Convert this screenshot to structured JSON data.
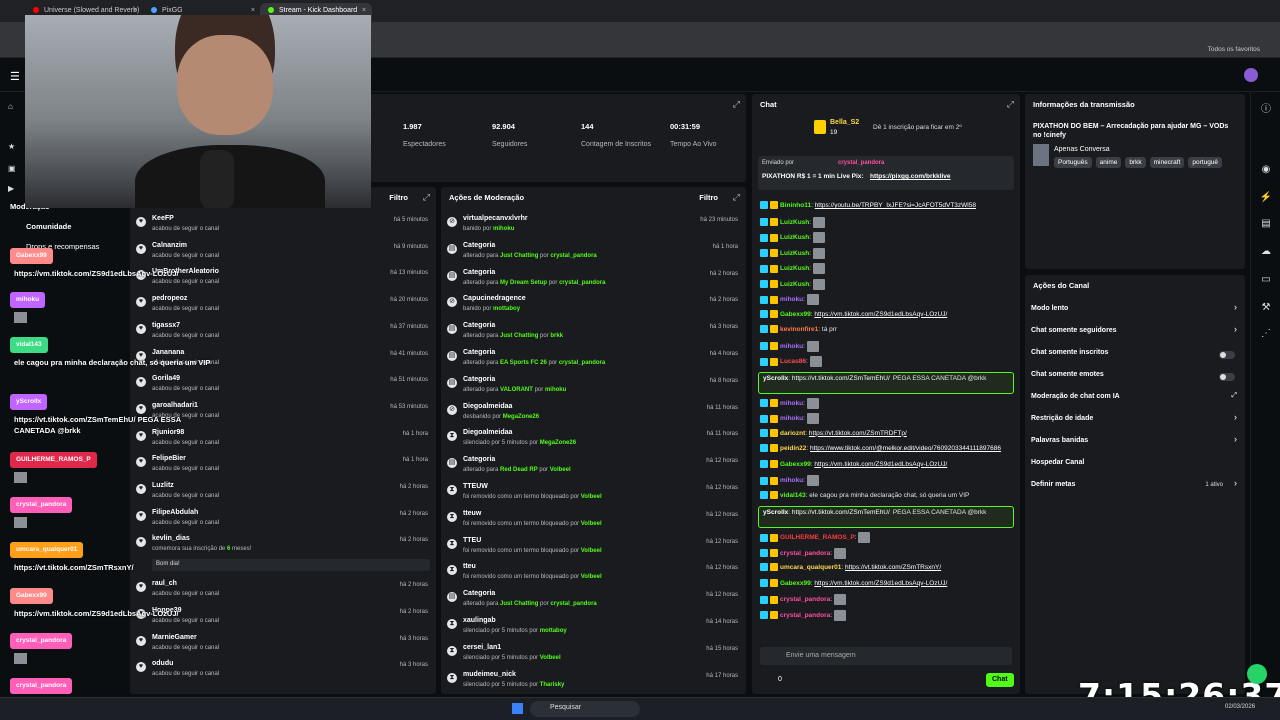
{
  "browser": {
    "tabs": [
      {
        "title": "Universe (Slowed and Reverb)",
        "color": "#ff0000"
      },
      {
        "title": "PixGG",
        "color": "#4aa3ff"
      },
      {
        "title": "Stream - Kick Dashboard",
        "color": "#53fc18"
      }
    ],
    "bookmarks_label": "Todos os favoritos"
  },
  "sidebar_menu": {
    "moderation": "Moderação",
    "community": "Comunidade",
    "drops": "Drops e recompensas"
  },
  "stats": [
    {
      "value": "1.987",
      "label": "Espectadores"
    },
    {
      "value": "92.904",
      "label": "Seguidores"
    },
    {
      "value": "144",
      "label": "Contagem de Inscritos"
    },
    {
      "value": "00:31:59",
      "label": "Tempo Ao Vivo"
    }
  ],
  "activity_feed": {
    "filter": "Filtro",
    "items": [
      {
        "name": "KeeFP",
        "desc": "acabou de seguir o canal",
        "time": "há 5 minutos"
      },
      {
        "name": "Calnanzim",
        "desc": "acabou de seguir o canal",
        "time": "há 9 minutos"
      },
      {
        "name": "UmBrotherAleatorio",
        "desc": "acabou de seguir o canal",
        "time": "há 13 minutos"
      },
      {
        "name": "pedropeoz",
        "desc": "acabou de seguir o canal",
        "time": "há 20 minutos"
      },
      {
        "name": "tigassx7",
        "desc": "acabou de seguir o canal",
        "time": "há 37 minutos"
      },
      {
        "name": "Jananana",
        "desc": "acabou de seguir o canal",
        "time": "há 41 minutos"
      },
      {
        "name": "Gorila49",
        "desc": "acabou de seguir o canal",
        "time": "há 51 minutos"
      },
      {
        "name": "garoalhadari1",
        "desc": "acabou de seguir o canal",
        "time": "há 53 minutos"
      },
      {
        "name": "Rjunior98",
        "desc": "acabou de seguir o canal",
        "time": "há 1 hora"
      },
      {
        "name": "FelipeBier",
        "desc": "acabou de seguir o canal",
        "time": "há 1 hora"
      },
      {
        "name": "Luzlitz",
        "desc": "acabou de seguir o canal",
        "time": "há 2 horas"
      },
      {
        "name": "FilipeAbdulah",
        "desc": "acabou de seguir o canal",
        "time": "há 2 horas"
      },
      {
        "name": "kevlin_dias",
        "desc": "comemora sua inscrição de",
        "months": "6",
        "suffix": "meses!",
        "time": "há 2 horas"
      },
      {
        "name": "raul_ch",
        "desc": "acabou de seguir o canal",
        "time": "há 2 horas"
      },
      {
        "name": "Hoppe39",
        "desc": "acabou de seguir o canal",
        "time": "há 2 horas"
      },
      {
        "name": "MarnieGamer",
        "desc": "acabou de seguir o canal",
        "time": "há 3 horas"
      },
      {
        "name": "odudu",
        "desc": "acabou de seguir o canal",
        "time": "há 3 horas"
      }
    ],
    "sub_message": "Bom dia!"
  },
  "moderation": {
    "title": "Ações de Moderação",
    "filter": "Filtro",
    "items": [
      {
        "icon": "ban",
        "name": "virtualpecanvxlvrhr",
        "desc": "banido por",
        "actor": "mihoku",
        "time": "há 23 minutos"
      },
      {
        "icon": "category",
        "name": "Categoria",
        "desc": "alterado para",
        "target": "Just Chatting",
        "by": "crystal_pandora",
        "time": "há 1 hora"
      },
      {
        "icon": "category",
        "name": "Categoria",
        "desc": "alterado para",
        "target": "My Dream Setup",
        "by": "crystal_pandora",
        "time": "há 2 horas"
      },
      {
        "icon": "ban",
        "name": "Capucinedragence",
        "desc": "banido por",
        "actor": "mottaboy",
        "time": "há 2 horas"
      },
      {
        "icon": "category",
        "name": "Categoria",
        "desc": "alterado para",
        "target": "Just Chatting",
        "by": "brkk",
        "time": "há 3 horas"
      },
      {
        "icon": "category",
        "name": "Categoria",
        "desc": "alterado para",
        "target": "EA Sports FC 26",
        "by": "crystal_pandora",
        "time": "há 4 horas"
      },
      {
        "icon": "category",
        "name": "Categoria",
        "desc": "alterado para",
        "target": "VALORANT",
        "by": "mihoku",
        "time": "há 8 horas"
      },
      {
        "icon": "ban",
        "name": "Diegoalmeidaa",
        "desc": "desbanido por",
        "actor": "MegaZone26",
        "time": "há 11 horas"
      },
      {
        "icon": "timeout",
        "name": "Diegoalmeidaa",
        "desc": "silenciado por 5 minutos por",
        "actor": "MegaZone26",
        "time": "há 11 horas"
      },
      {
        "icon": "category",
        "name": "Categoria",
        "desc": "alterado para",
        "target": "Red Dead RP",
        "by": "Volbeel",
        "time": "há 12 horas"
      },
      {
        "icon": "clock",
        "name": "TTEUW",
        "desc": "foi removido como um termo bloqueado por",
        "actor": "Volbeel",
        "time": "há 12 horas"
      },
      {
        "icon": "clock",
        "name": "tteuw",
        "desc": "foi removido como um termo bloqueado por",
        "actor": "Volbeel",
        "time": "há 12 horas"
      },
      {
        "icon": "clock",
        "name": "TTEU",
        "desc": "foi removido como um termo bloqueado por",
        "actor": "Volbeel",
        "time": "há 12 horas"
      },
      {
        "icon": "clock",
        "name": "tteu",
        "desc": "foi removido como um termo bloqueado por",
        "actor": "Volbeel",
        "time": "há 12 horas"
      },
      {
        "icon": "category",
        "name": "Categoria",
        "desc": "alterado para",
        "target": "Just Chatting",
        "by": "crystal_pandora",
        "time": "há 12 horas"
      },
      {
        "icon": "timeout",
        "name": "xaulingab",
        "desc": "silenciado por 5 minutos por",
        "actor": "mottaboy",
        "time": "há 14 horas"
      },
      {
        "icon": "timeout",
        "name": "cersei_lan1",
        "desc": "silenciado por 5 minutos por",
        "actor": "Volbeel",
        "time": "há 15 horas"
      },
      {
        "icon": "timeout",
        "name": "mudeimeu_nick",
        "desc": "silenciado por 5 minutos por",
        "actor": "Tharisky",
        "time": "há 17 horas"
      }
    ]
  },
  "chat": {
    "title": "Chat",
    "top_sub_user": "Bella_S2",
    "top_sub_count": "19",
    "top_sub_note": "Dê 1 inscrição para ficar em 2º",
    "pinned_by_label": "Enviado por",
    "pinned_by": "crystal_pandora",
    "pinned_text": "PIXATHON R$ 1 = 1 min Live Pix:",
    "pinned_link": "https://pixgg.com/brkklive",
    "messages": [
      {
        "user": "Bininho11",
        "color": "#53fc18",
        "text": "https://youtu.be/TRPBY_IxJFE?si=JcAFOT5dVT3zWl58",
        "link": true
      },
      {
        "user": "LuizKush",
        "color": "#53fc18",
        "text": "",
        "emote": true
      },
      {
        "user": "LuizKush",
        "color": "#53fc18",
        "text": "",
        "emote": true
      },
      {
        "user": "LuizKush",
        "color": "#53fc18",
        "text": "",
        "emote": true
      },
      {
        "user": "LuizKush",
        "color": "#53fc18",
        "text": "",
        "emote": true
      },
      {
        "user": "LuizKush",
        "color": "#53fc18",
        "text": "",
        "emote": true
      },
      {
        "user": "mihoku",
        "color": "#a970ff",
        "text": "",
        "emote": true
      },
      {
        "user": "Gabexx99",
        "color": "#53fc18",
        "text": "https://vm.tiktok.com/ZS9d1edLbsAqv-LOzUJ/",
        "link": true
      },
      {
        "user": "kevinonfire1",
        "color": "#ff7a45",
        "text": "tá prr"
      },
      {
        "user": "mihoku",
        "color": "#a970ff",
        "text": "",
        "emote": true
      },
      {
        "user": "Lucas86",
        "color": "#ff4d4d",
        "text": "",
        "emote": true
      }
    ],
    "highlight1_user": "yScrollx",
    "highlight1_link": "https://vt.tiktok.com/ZSmTemEhU/",
    "highlight1_text": "PEGA ESSA CANETADA @brkk",
    "messages2": [
      {
        "user": "mihoku",
        "color": "#a970ff",
        "text": "",
        "emote": true
      },
      {
        "user": "mihoku",
        "color": "#a970ff",
        "text": "",
        "emote": true
      },
      {
        "user": "darioznt",
        "color": "#ffd84a",
        "text": "https://vt.tiktok.com/ZSmTRDFTp/",
        "link": true
      },
      {
        "user": "peidin22",
        "color": "#ffd84a",
        "text": "https://www.tiktok.com/@melkor.edit/video/7609203344111897686",
        "link": true
      },
      {
        "user": "Gabexx99",
        "color": "#53fc18",
        "text": "https://vm.tiktok.com/ZS9d1edLbsAqv-LOzUJ/",
        "link": true
      },
      {
        "user": "mihoku",
        "color": "#a970ff",
        "text": "",
        "emote": true
      },
      {
        "user": "vidal143",
        "color": "#53fc18",
        "text": "ele cagou pra minha declaração chat, só queria um VIP"
      }
    ],
    "highlight2_user": "yScrollx",
    "highlight2_link": "https://vt.tiktok.com/ZSmTemEhU/",
    "highlight2_text": "PEGA ESSA CANETADA @brkk",
    "messages3": [
      {
        "user": "GUILHERME_RAMOS_P",
        "color": "#ff3b3b",
        "text": "",
        "emote": true
      },
      {
        "user": "crystal_pandora",
        "color": "#ff4fa3",
        "text": "",
        "emote": true
      },
      {
        "user": "umcara_qualquer01",
        "color": "#ffd84a",
        "text": "https://vt.tiktok.com/ZSmTRsxnY/",
        "link": true
      },
      {
        "user": "Gabexx99",
        "color": "#53fc18",
        "text": "https://vm.tiktok.com/ZS9d1edLbsAqv-LOzUJ/",
        "link": true
      },
      {
        "user": "crystal_pandora",
        "color": "#ff4fa3",
        "text": "",
        "emote": true
      },
      {
        "user": "crystal_pandora",
        "color": "#ff4fa3",
        "text": "",
        "emote": true
      }
    ],
    "input_placeholder": "Envie uma mensagem",
    "viewer_count": "0",
    "send_label": "Chat"
  },
  "stream_info": {
    "title": "Informações da transmissão",
    "stream_title": "PIXATHON DO BEM – Arrecadação para ajudar MG – VODs no !cinefy",
    "category": "Apenas Conversa",
    "tags": [
      "Português",
      "anime",
      "brkk",
      "minecraft",
      "portuguê"
    ]
  },
  "channel_actions": {
    "title": "Ações do Canal",
    "items": [
      {
        "label": "Modo lento",
        "ctl": "chevron"
      },
      {
        "label": "Chat somente seguidores",
        "ctl": "chevron"
      },
      {
        "label": "Chat somente inscritos",
        "ctl": "toggle"
      },
      {
        "label": "Chat somente emotes",
        "ctl": "toggle"
      },
      {
        "label": "Moderação de chat com IA",
        "ctl": "external"
      },
      {
        "label": "Restrição de idade",
        "ctl": "chevron"
      },
      {
        "label": "Palavras banidas",
        "ctl": "chevron"
      },
      {
        "label": "Hospedar Canal",
        "ctl": "none"
      },
      {
        "label": "Definir metas",
        "ctl": "chevron",
        "extra": "1 ativo"
      }
    ]
  },
  "overlay_chat": [
    {
      "user": "Gabexx99",
      "color": "#ff8a8a",
      "text": "https://vm.tiktok.com/ZS9d1edLbsAqv-LOzUJ/"
    },
    {
      "user": "mihoku",
      "color": "#c065ff",
      "text": ""
    },
    {
      "user": "vidal143",
      "color": "#3ddc84",
      "text": "ele cagou pra minha declaração chat, só queria um VIP"
    },
    {
      "user": "yScrollx",
      "color": "#c065ff",
      "text": "https://vt.tiktok.com/ZSmTemEhU/ PEGA ESSA CANETADA @brkk"
    },
    {
      "user": "GUILHERME_RAMOS_P",
      "color": "#e0284a",
      "text": ""
    },
    {
      "user": "crystal_pandora",
      "color": "#ff5fb8",
      "text": ""
    },
    {
      "user": "umcara_qualquer01",
      "color": "#ff9f1a",
      "text": "https://vt.tiktok.com/ZSmTRsxnY/"
    },
    {
      "user": "Gabexx99",
      "color": "#ff8a8a",
      "text": "https://vm.tiktok.com/ZS9d1edLbsAqv-LOzUJ/"
    },
    {
      "user": "crystal_pandora",
      "color": "#ff5fb8",
      "text": ""
    },
    {
      "user": "crystal_pandora",
      "color": "#ff5fb8",
      "text": ""
    }
  ],
  "clock": "7:15:26:37",
  "taskbar": {
    "search": "Pesquisar",
    "time": "02/03/2026"
  }
}
